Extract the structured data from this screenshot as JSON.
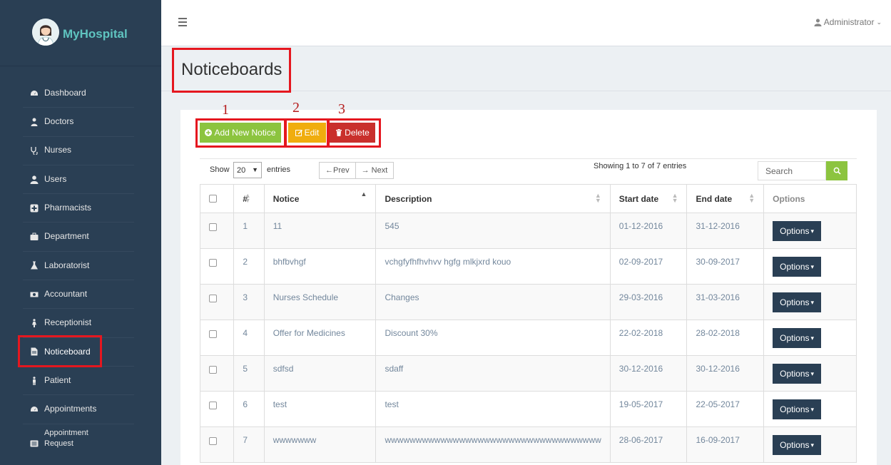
{
  "brand": {
    "name": "MyHospital"
  },
  "sidebar": {
    "items": [
      {
        "label": "Dashboard",
        "icon": "dashboard-icon"
      },
      {
        "label": "Doctors",
        "icon": "user-md-icon"
      },
      {
        "label": "Nurses",
        "icon": "stethoscope-icon"
      },
      {
        "label": "Users",
        "icon": "user-icon"
      },
      {
        "label": "Pharmacists",
        "icon": "plus-square-icon"
      },
      {
        "label": "Department",
        "icon": "briefcase-icon"
      },
      {
        "label": "Laboratorist",
        "icon": "flask-icon"
      },
      {
        "label": "Accountant",
        "icon": "money-icon"
      },
      {
        "label": "Receptionist",
        "icon": "female-icon"
      },
      {
        "label": "Noticeboard",
        "icon": "file-icon",
        "active": true
      },
      {
        "label": "Patient",
        "icon": "male-icon"
      },
      {
        "label": "Appointments",
        "icon": "dashboard-icon"
      },
      {
        "label": "Appointment Request",
        "icon": "list-alt-icon"
      }
    ]
  },
  "header": {
    "user": "Administrator"
  },
  "page": {
    "title": "Noticeboards"
  },
  "actions": {
    "add_label": "Add New Notice",
    "edit_label": "Edit",
    "delete_label": "Delete"
  },
  "annotations": [
    "1",
    "2",
    "3"
  ],
  "table_controls": {
    "show_label": "Show",
    "page_size": "20",
    "entries_label": "entries",
    "prev_label": "←Prev",
    "next_label": "→ Next",
    "info": "Showing 1 to 7 of 7 entries",
    "search_placeholder": "Search"
  },
  "table": {
    "columns": [
      "#",
      "Notice",
      "Description",
      "Start date",
      "End date",
      "Options"
    ],
    "rows": [
      {
        "num": "1",
        "notice": "11",
        "description": "545",
        "start": "01-12-2016",
        "end": "31-12-2016"
      },
      {
        "num": "2",
        "notice": "bhfbvhgf",
        "description": "vchgfyfhfhvhvv hgfg mlkjxrd kouo",
        "start": "02-09-2017",
        "end": "30-09-2017"
      },
      {
        "num": "3",
        "notice": "Nurses Schedule",
        "description": "Changes",
        "start": "29-03-2016",
        "end": "31-03-2016"
      },
      {
        "num": "4",
        "notice": "Offer for Medicines",
        "description": "Discount 30%",
        "start": "22-02-2018",
        "end": "28-02-2018"
      },
      {
        "num": "5",
        "notice": "sdfsd",
        "description": "sdaff",
        "start": "30-12-2016",
        "end": "30-12-2016"
      },
      {
        "num": "6",
        "notice": "test",
        "description": "test",
        "start": "19-05-2017",
        "end": "22-05-2017"
      },
      {
        "num": "7",
        "notice": "wwwwwww",
        "description": "wwwwwwwwwwwwwwwwwwwwwwwwwwwwwwwwwww",
        "start": "28-06-2017",
        "end": "16-09-2017"
      }
    ],
    "options_label": "Options"
  },
  "colors": {
    "sidebar": "#2a3f54",
    "add": "#8cc43f",
    "edit": "#f0ad0e",
    "delete": "#c9302c",
    "highlight": "#e5171f"
  }
}
